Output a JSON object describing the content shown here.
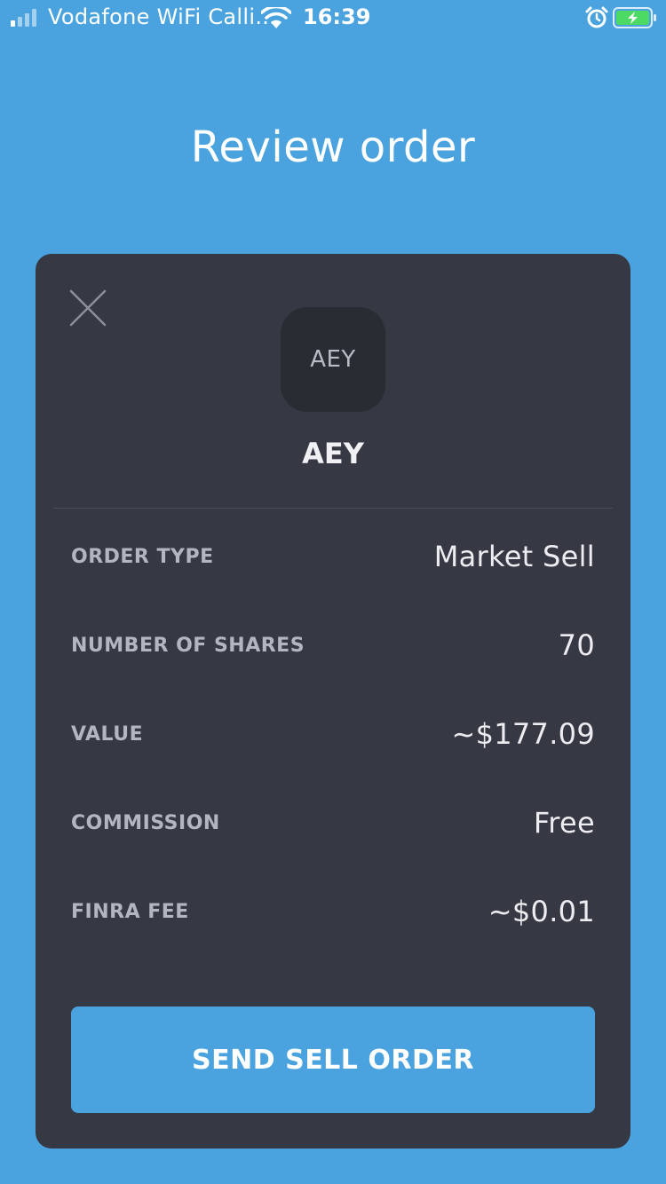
{
  "status_bar": {
    "carrier": "Vodafone WiFi Calli...",
    "time": "16:39",
    "icons": [
      "signal-icon",
      "wifi-icon",
      "alarm-icon",
      "battery-charging-icon"
    ]
  },
  "page": {
    "title": "Review order"
  },
  "card": {
    "ticker_logo_text": "AEY",
    "ticker_name": "AEY",
    "details": [
      {
        "label": "ORDER TYPE",
        "value": "Market Sell"
      },
      {
        "label": "NUMBER OF SHARES",
        "value": "70"
      },
      {
        "label": "VALUE",
        "value": "~$177.09"
      },
      {
        "label": "COMMISSION",
        "value": "Free"
      },
      {
        "label": "FINRA FEE",
        "value": "~$0.01"
      }
    ],
    "send_button_label": "SEND SELL ORDER"
  },
  "colors": {
    "background": "#4aa3de",
    "card": "#363843",
    "logo_tile": "#2a2c33",
    "accent_button": "#4aa3de",
    "battery_fill": "#4cd964"
  }
}
